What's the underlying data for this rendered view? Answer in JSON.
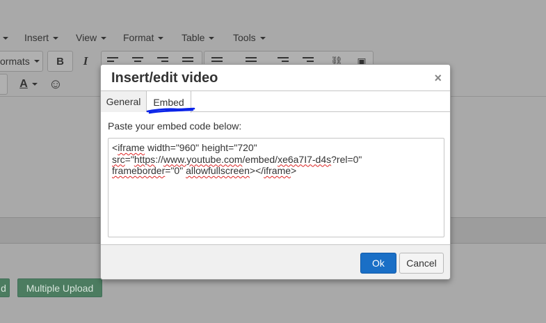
{
  "menubar": {
    "items": [
      {
        "label": "Insert"
      },
      {
        "label": "View"
      },
      {
        "label": "Format"
      },
      {
        "label": "Table"
      },
      {
        "label": "Tools"
      }
    ]
  },
  "toolbar": {
    "formats_label": "ormats",
    "bold_label": "B",
    "italic_label": "I",
    "text_color_label": "A",
    "emoticon_glyph": "☺"
  },
  "buttons": {
    "upload_partial_label": "d",
    "multiple_upload_label": "Multiple Upload"
  },
  "dialog": {
    "title": "Insert/edit video",
    "close_glyph": "×",
    "tabs": [
      {
        "label": "General"
      },
      {
        "label": "Embed"
      }
    ],
    "embed_label": "Paste your embed code below:",
    "embed_code": {
      "line1": [
        "<",
        "iframe",
        " width=\"960\" height=\"720\""
      ],
      "line2": [
        "src",
        "=\"",
        "https",
        "://",
        "www.youtube.com",
        "/embed/",
        "xe6a7I7-d4s",
        "?rel=0\""
      ],
      "line3": [
        "frameborder",
        "=\"0\" ",
        "allowfullscreen",
        "></",
        "iframe",
        ">"
      ]
    },
    "ok_label": "Ok",
    "cancel_label": "Cancel"
  },
  "colors": {
    "ok_button": "#1a6fc6",
    "annotation_underline": "#0b24e8",
    "upload_button": "#4c7c60"
  }
}
